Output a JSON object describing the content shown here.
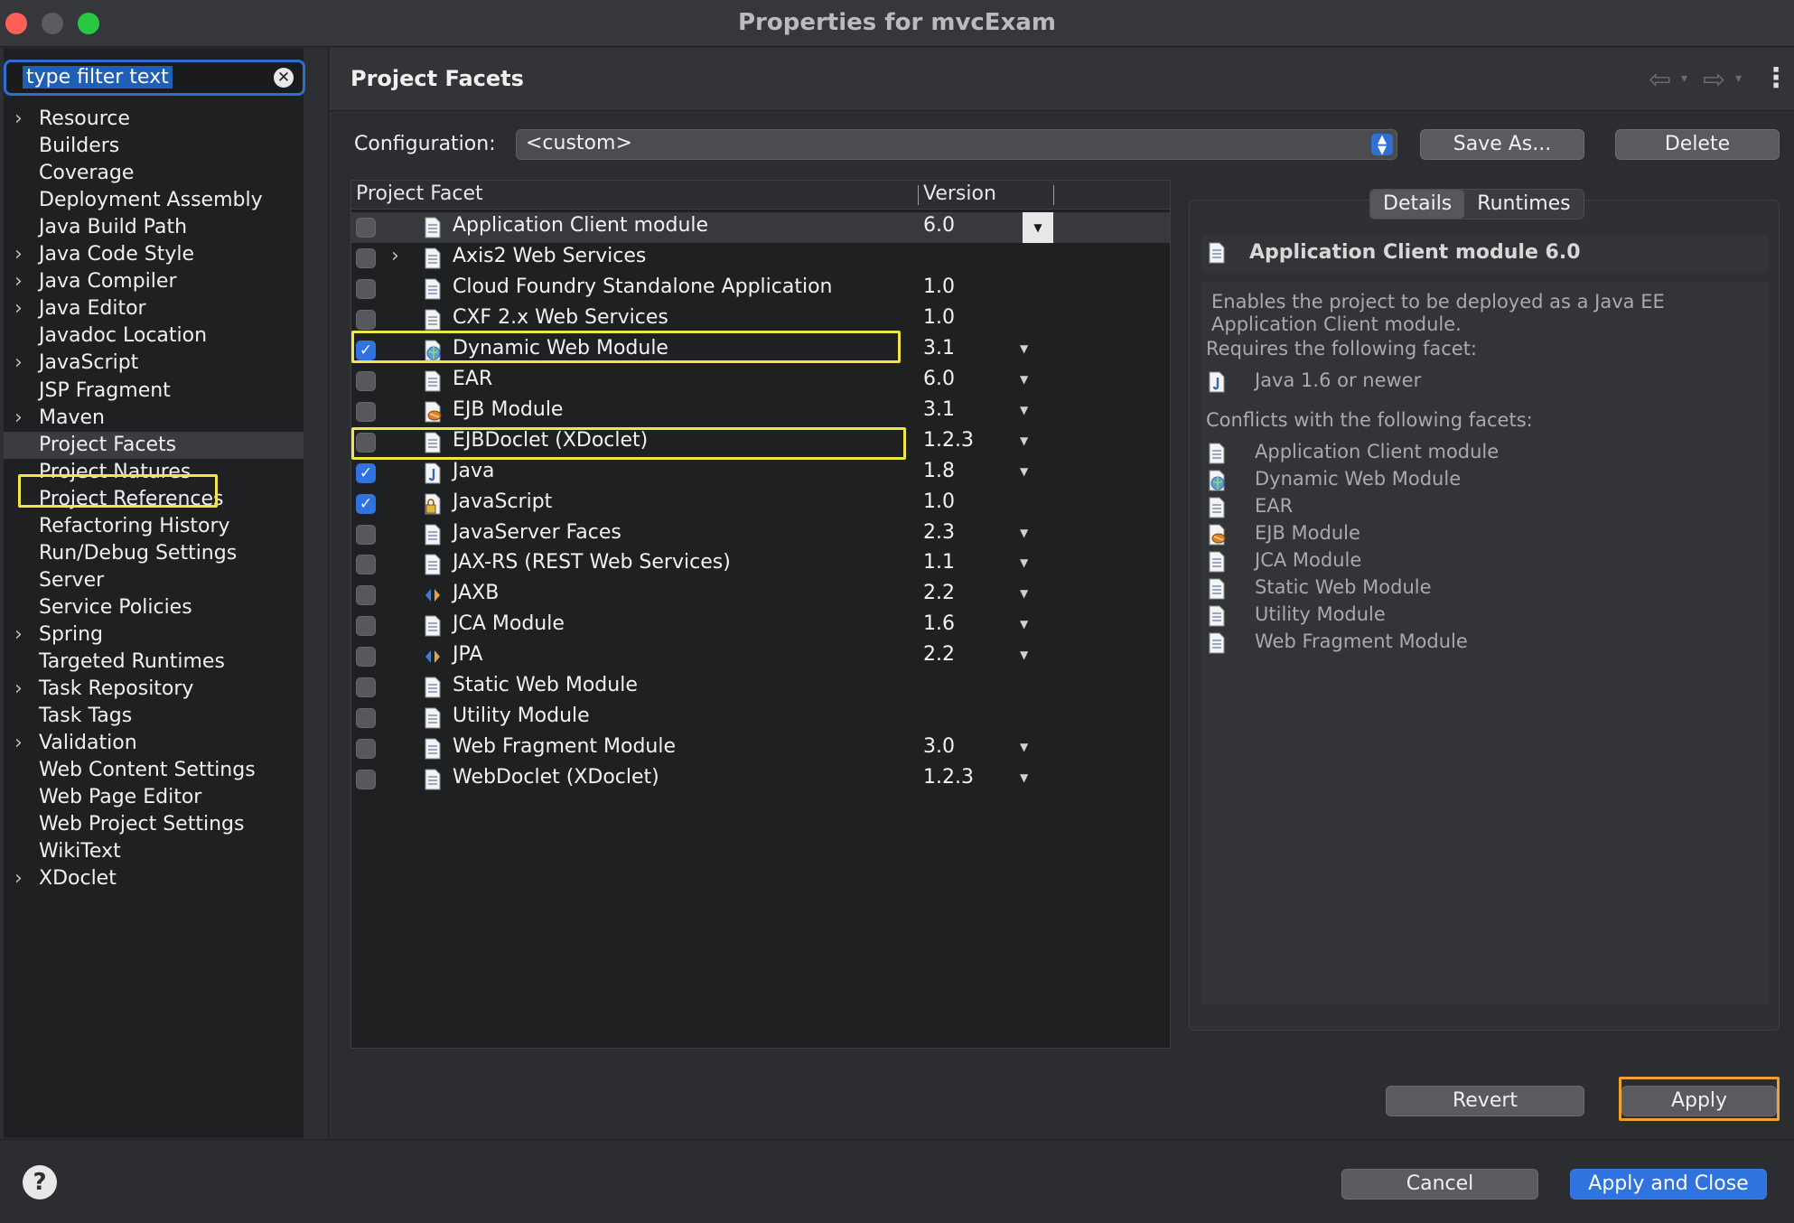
{
  "window": {
    "title": "Properties for mvcExam"
  },
  "filter": {
    "value": "type filter text"
  },
  "sidebar": {
    "items": [
      {
        "label": "Resource",
        "expandable": true
      },
      {
        "label": "Builders",
        "expandable": false
      },
      {
        "label": "Coverage",
        "expandable": false
      },
      {
        "label": "Deployment Assembly",
        "expandable": false
      },
      {
        "label": "Java Build Path",
        "expandable": false
      },
      {
        "label": "Java Code Style",
        "expandable": true
      },
      {
        "label": "Java Compiler",
        "expandable": true
      },
      {
        "label": "Java Editor",
        "expandable": true
      },
      {
        "label": "Javadoc Location",
        "expandable": false
      },
      {
        "label": "JavaScript",
        "expandable": true
      },
      {
        "label": "JSP Fragment",
        "expandable": false
      },
      {
        "label": "Maven",
        "expandable": true
      },
      {
        "label": "Project Facets",
        "expandable": false
      },
      {
        "label": "Project Natures",
        "expandable": false
      },
      {
        "label": "Project References",
        "expandable": false
      },
      {
        "label": "Refactoring History",
        "expandable": false
      },
      {
        "label": "Run/Debug Settings",
        "expandable": false
      },
      {
        "label": "Server",
        "expandable": false
      },
      {
        "label": "Service Policies",
        "expandable": false
      },
      {
        "label": "Spring",
        "expandable": true
      },
      {
        "label": "Targeted Runtimes",
        "expandable": false
      },
      {
        "label": "Task Repository",
        "expandable": true
      },
      {
        "label": "Task Tags",
        "expandable": false
      },
      {
        "label": "Validation",
        "expandable": true
      },
      {
        "label": "Web Content Settings",
        "expandable": false
      },
      {
        "label": "Web Page Editor",
        "expandable": false
      },
      {
        "label": "Web Project Settings",
        "expandable": false
      },
      {
        "label": "WikiText",
        "expandable": false
      },
      {
        "label": "XDoclet",
        "expandable": true
      }
    ],
    "selected_index": 12
  },
  "page": {
    "title": "Project Facets"
  },
  "configuration": {
    "label": "Configuration:",
    "value": "<custom>"
  },
  "buttons": {
    "save_as": "Save As...",
    "delete": "Delete",
    "revert": "Revert",
    "apply": "Apply",
    "cancel": "Cancel",
    "apply_and_close": "Apply and Close",
    "help": "?"
  },
  "facets_table": {
    "columns": [
      "Project Facet",
      "Version"
    ],
    "rows": [
      {
        "name": "Application Client module",
        "version": "6.0",
        "checked": false,
        "icon": "document-icon",
        "dropdown": true
      },
      {
        "name": "Axis2 Web Services",
        "version": "",
        "checked": false,
        "icon": "document-icon",
        "dropdown": false,
        "expandable": true
      },
      {
        "name": "Cloud Foundry Standalone Application",
        "version": "1.0",
        "checked": false,
        "icon": "document-icon",
        "dropdown": false
      },
      {
        "name": "CXF 2.x Web Services",
        "version": "1.0",
        "checked": false,
        "icon": "document-icon",
        "dropdown": false
      },
      {
        "name": "Dynamic Web Module",
        "version": "3.1",
        "checked": true,
        "icon": "globe-icon",
        "dropdown": true
      },
      {
        "name": "EAR",
        "version": "6.0",
        "checked": false,
        "icon": "document-icon",
        "dropdown": true
      },
      {
        "name": "EJB Module",
        "version": "3.1",
        "checked": false,
        "icon": "bean-icon",
        "dropdown": true
      },
      {
        "name": "EJBDoclet (XDoclet)",
        "version": "1.2.3",
        "checked": false,
        "icon": "document-icon",
        "dropdown": true
      },
      {
        "name": "Java",
        "version": "1.8",
        "checked": true,
        "icon": "java-icon",
        "dropdown": true
      },
      {
        "name": "JavaScript",
        "version": "1.0",
        "checked": true,
        "icon": "lock-doc-icon",
        "dropdown": false
      },
      {
        "name": "JavaServer Faces",
        "version": "2.3",
        "checked": false,
        "icon": "document-icon",
        "dropdown": true
      },
      {
        "name": "JAX-RS (REST Web Services)",
        "version": "1.1",
        "checked": false,
        "icon": "document-icon",
        "dropdown": true
      },
      {
        "name": "JAXB",
        "version": "2.2",
        "checked": false,
        "icon": "arrows-icon",
        "dropdown": true
      },
      {
        "name": "JCA Module",
        "version": "1.6",
        "checked": false,
        "icon": "document-icon",
        "dropdown": true
      },
      {
        "name": "JPA",
        "version": "2.2",
        "checked": false,
        "icon": "arrows-icon",
        "dropdown": true
      },
      {
        "name": "Static Web Module",
        "version": "",
        "checked": false,
        "icon": "document-icon",
        "dropdown": false
      },
      {
        "name": "Utility Module",
        "version": "",
        "checked": false,
        "icon": "document-icon",
        "dropdown": false
      },
      {
        "name": "Web Fragment Module",
        "version": "3.0",
        "checked": false,
        "icon": "document-icon",
        "dropdown": true
      },
      {
        "name": "WebDoclet (XDoclet)",
        "version": "1.2.3",
        "checked": false,
        "icon": "document-icon",
        "dropdown": true
      }
    ]
  },
  "details": {
    "tabs": [
      "Details",
      "Runtimes"
    ],
    "active_tab": "Details",
    "heading": "Application Client module 6.0",
    "description": "Enables the project to be deployed as a Java EE Application Client module.",
    "requires_label": "Requires the following facet:",
    "requires": [
      {
        "name": "Java 1.6 or newer",
        "icon": "java-icon"
      }
    ],
    "conflicts_label": "Conflicts with the following facets:",
    "conflicts": [
      {
        "name": "Application Client module",
        "icon": "document-icon"
      },
      {
        "name": "Dynamic Web Module",
        "icon": "globe-icon"
      },
      {
        "name": "EAR",
        "icon": "document-icon"
      },
      {
        "name": "EJB Module",
        "icon": "bean-icon"
      },
      {
        "name": "JCA Module",
        "icon": "document-icon"
      },
      {
        "name": "Static Web Module",
        "icon": "document-icon"
      },
      {
        "name": "Utility Module",
        "icon": "document-icon"
      },
      {
        "name": "Web Fragment Module",
        "icon": "document-icon"
      }
    ]
  },
  "colors": {
    "accent": "#2f73e0",
    "highlight_box": "#f0e64a",
    "apply_highlight": "#f0a030"
  }
}
